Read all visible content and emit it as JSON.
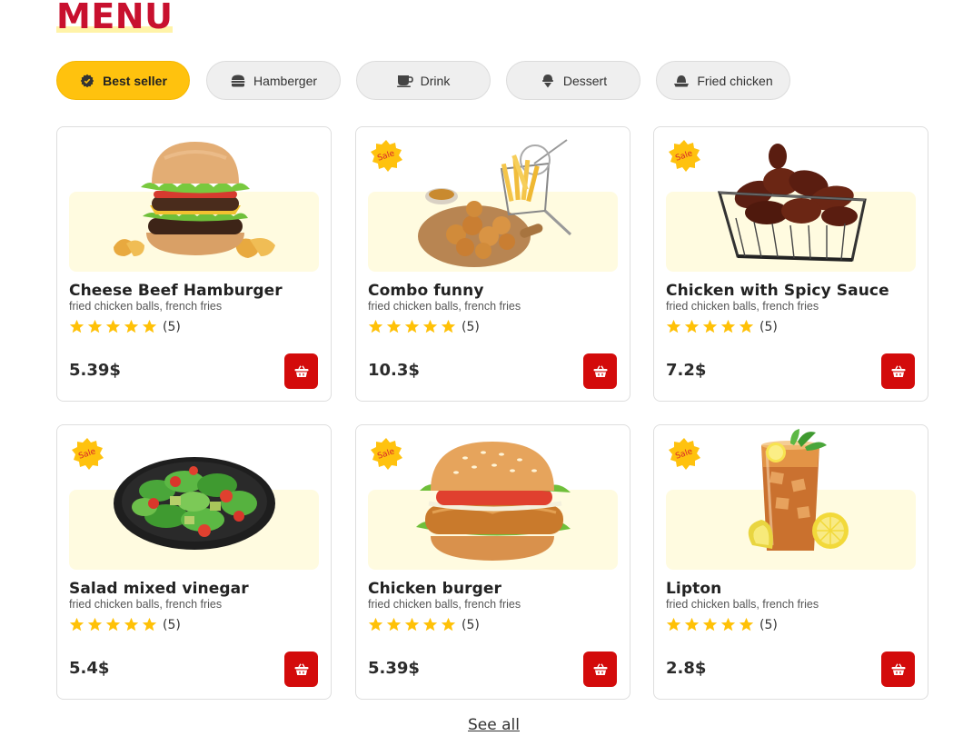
{
  "page": {
    "title": "MENU",
    "see_all": "See all"
  },
  "tabs": [
    {
      "label": "Best seller",
      "icon": "badge-icon",
      "active": true
    },
    {
      "label": "Hamberger",
      "icon": "burger-icon",
      "active": false
    },
    {
      "label": "Drink",
      "icon": "cup-icon",
      "active": false
    },
    {
      "label": "Dessert",
      "icon": "ice-cream-icon",
      "active": false
    },
    {
      "label": "Fried chicken",
      "icon": "chicken-icon",
      "active": false
    }
  ],
  "products": [
    {
      "name": "Cheese Beef Hamburger",
      "desc": "fried chicken balls, french fries",
      "rating": 5,
      "count": "(5)",
      "price": "5.39$",
      "sale": false,
      "image": "hamburger-image",
      "sale_label": ""
    },
    {
      "name": "Combo funny",
      "desc": "fried chicken balls, french fries",
      "rating": 5,
      "count": "(5)",
      "price": "10.3$",
      "sale": true,
      "image": "chicken-fries-combo-image",
      "sale_label": "Sale"
    },
    {
      "name": "Chicken with Spicy Sauce",
      "desc": "fried chicken balls, french fries",
      "rating": 5,
      "count": "(5)",
      "price": "7.2$",
      "sale": true,
      "image": "spicy-wings-image",
      "sale_label": "Sale"
    },
    {
      "name": "Salad mixed vinegar",
      "desc": "fried chicken balls, french fries",
      "rating": 5,
      "count": "(5)",
      "price": "5.4$",
      "sale": true,
      "image": "salad-image",
      "sale_label": "Sale"
    },
    {
      "name": "Chicken burger",
      "desc": "fried chicken balls, french fries",
      "rating": 5,
      "count": "(5)",
      "price": "5.39$",
      "sale": true,
      "image": "chicken-burger-image",
      "sale_label": "Sale"
    },
    {
      "name": "Lipton",
      "desc": "fried chicken balls, french fries",
      "rating": 5,
      "count": "(5)",
      "price": "2.8$",
      "sale": true,
      "image": "iced-tea-image",
      "sale_label": "Sale"
    }
  ],
  "colors": {
    "brand_red": "#c8102e",
    "active_tab": "#ffc20e",
    "star": "#ffc107",
    "cart": "#d30b0b",
    "image_bg": "#fffbe0"
  }
}
